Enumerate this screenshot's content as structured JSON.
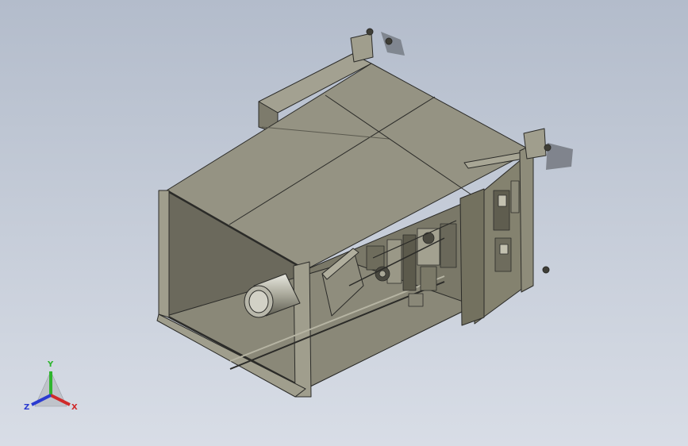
{
  "viewport": {
    "background_top": "#b3bccb",
    "background_bottom": "#d8dde6"
  },
  "model": {
    "body_color": "#8c8a7a",
    "edge_color": "#2b2b28"
  },
  "triad": {
    "x_label": "X",
    "y_label": "Y",
    "z_label": "Z",
    "x_color": "#d02a2a",
    "y_color": "#2fb52f",
    "z_color": "#2a3ad0"
  }
}
